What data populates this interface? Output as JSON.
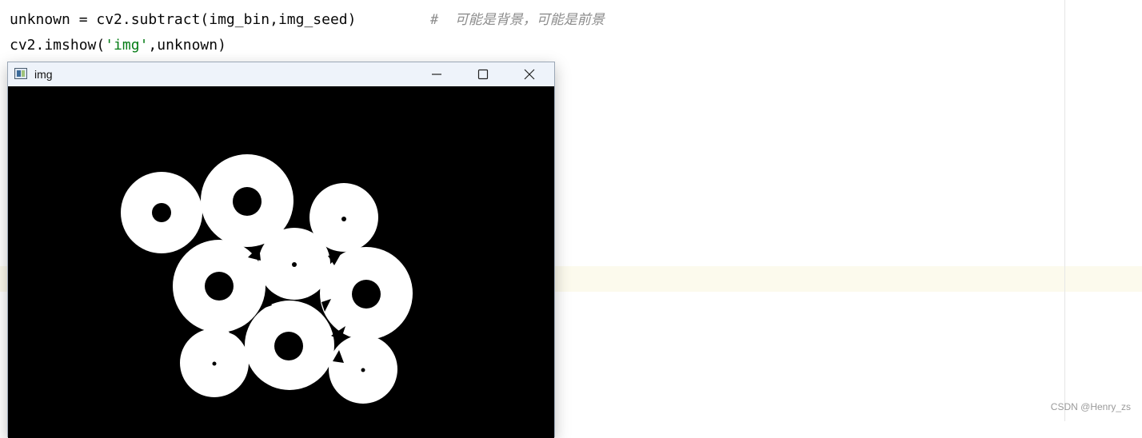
{
  "editor": {
    "line1_code": "unknown = cv2.subtract(img_bin,img_seed)",
    "line1_comment": "#  可能是背景，可能是前景",
    "line2_prefix": "cv2.imshow(",
    "line2_string": "'img'",
    "line2_suffix": ",unknown)"
  },
  "window": {
    "title": "img",
    "icons": {
      "app": "image-window-icon",
      "minimize": "minimize-icon",
      "maximize": "maximize-icon",
      "close": "close-icon"
    }
  },
  "watermark": "CSDN @Henry_zs",
  "colors": {
    "string": "#067d17",
    "comment": "#8c8c8c",
    "current_line": "#fcfaed",
    "titlebar": "#eef3fa"
  }
}
